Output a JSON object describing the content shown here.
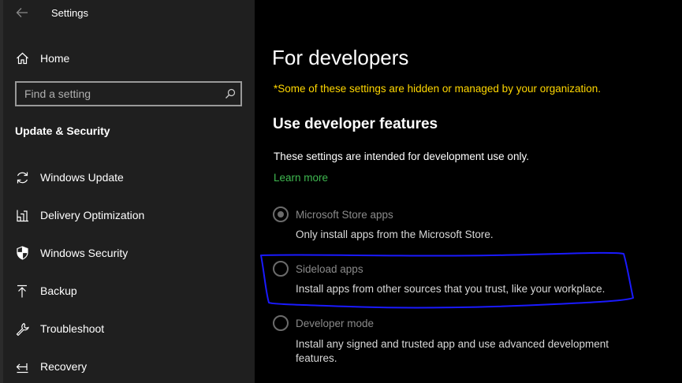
{
  "app": {
    "title": "Settings"
  },
  "sidebar": {
    "home_label": "Home",
    "search_placeholder": "Find a setting",
    "section_heading": "Update & Security",
    "items": [
      {
        "label": "Windows Update",
        "icon": "refresh-icon"
      },
      {
        "label": "Delivery Optimization",
        "icon": "delivery-optimization-icon"
      },
      {
        "label": "Windows Security",
        "icon": "shield-icon"
      },
      {
        "label": "Backup",
        "icon": "backup-arrow-icon"
      },
      {
        "label": "Troubleshoot",
        "icon": "wrench-icon"
      },
      {
        "label": "Recovery",
        "icon": "recovery-icon"
      }
    ]
  },
  "main": {
    "title": "For developers",
    "org_notice": "*Some of these settings are hidden or managed by your organization.",
    "subheading": "Use developer features",
    "description": "These settings are intended for development use only.",
    "learn_more": "Learn more",
    "options": [
      {
        "label": "Microsoft Store apps",
        "description": "Only install apps from the Microsoft Store.",
        "checked": true
      },
      {
        "label": "Sideload apps",
        "description": "Install apps from other sources that you trust, like your workplace.",
        "checked": false
      },
      {
        "label": "Developer mode",
        "description": "Install any signed and trusted app and use advanced development features.",
        "checked": false
      }
    ]
  },
  "colors": {
    "sidebar_bg": "#1f1f1f",
    "main_bg": "#000000",
    "notice": "#ffd700",
    "link": "#3fb950",
    "annotation": "#1a1aff"
  }
}
